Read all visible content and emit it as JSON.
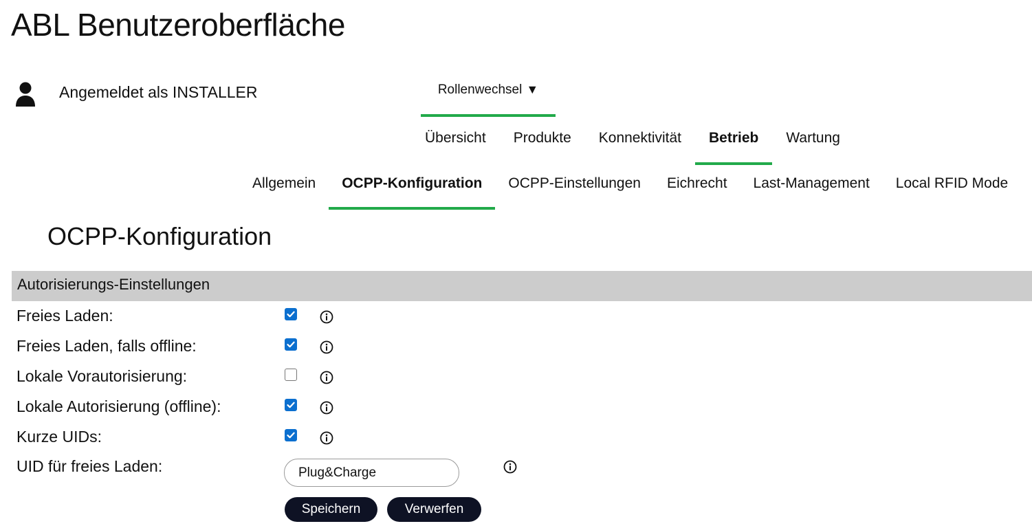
{
  "app": {
    "title": "ABL Benutzeroberfläche"
  },
  "user": {
    "logged_in_text": "Angemeldet als INSTALLER",
    "icon": "user-icon"
  },
  "role_switch": {
    "label": "Rollenwechsel",
    "caret": "▼"
  },
  "main_nav": {
    "items": [
      {
        "label": "Übersicht",
        "active": false
      },
      {
        "label": "Produkte",
        "active": false
      },
      {
        "label": "Konnektivität",
        "active": false
      },
      {
        "label": "Betrieb",
        "active": true
      },
      {
        "label": "Wartung",
        "active": false
      }
    ]
  },
  "sub_nav": {
    "items": [
      {
        "label": "Allgemein",
        "active": false
      },
      {
        "label": "OCPP-Konfiguration",
        "active": true
      },
      {
        "label": "OCPP-Einstellungen",
        "active": false
      },
      {
        "label": "Eichrecht",
        "active": false
      },
      {
        "label": "Last-Management",
        "active": false
      },
      {
        "label": "Local RFID Mode",
        "active": false
      }
    ]
  },
  "page": {
    "heading": "OCPP-Konfiguration"
  },
  "section": {
    "title": "Autorisierungs-Einstellungen",
    "settings": [
      {
        "label": "Freies Laden:",
        "checked": true
      },
      {
        "label": "Freies Laden, falls offline:",
        "checked": true
      },
      {
        "label": "Lokale Vorautorisierung:",
        "checked": false
      },
      {
        "label": "Lokale Autorisierung (offline):",
        "checked": true
      },
      {
        "label": "Kurze UIDs:",
        "checked": true
      }
    ],
    "uid_field": {
      "label": "UID für freies Laden:",
      "value": "Plug&Charge"
    }
  },
  "actions": {
    "save_label": "Speichern",
    "discard_label": "Verwerfen"
  },
  "colors": {
    "accent": "#22aa4a",
    "checkbox": "#0b6fcf",
    "button_bg": "#0e1224",
    "section_bg": "#cccccc"
  }
}
